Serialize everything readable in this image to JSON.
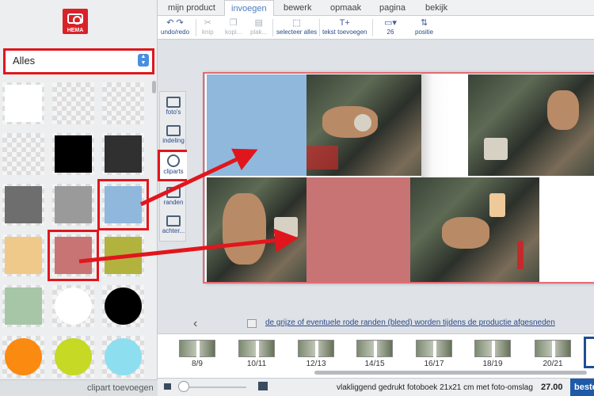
{
  "brand": {
    "name": "HEMA",
    "color": "#d8222a"
  },
  "category_select": {
    "value": "Alles"
  },
  "swatches": [
    {
      "color": "#ffffff",
      "shape": "square"
    },
    {
      "color": "transparent",
      "shape": "square"
    },
    {
      "color": "transparent",
      "shape": "square"
    },
    {
      "color": "transparent",
      "shape": "square"
    },
    {
      "color": "#000000",
      "shape": "square"
    },
    {
      "color": "#303030",
      "shape": "square"
    },
    {
      "color": "#6e6e6e",
      "shape": "square"
    },
    {
      "color": "#9a9a9a",
      "shape": "square"
    },
    {
      "color": "#8fb8dc",
      "shape": "square"
    },
    {
      "color": "#efc98a",
      "shape": "square"
    },
    {
      "color": "#c87474",
      "shape": "square"
    },
    {
      "color": "#b1b33e",
      "shape": "square"
    },
    {
      "color": "#a7c6a7",
      "shape": "square"
    },
    {
      "color": "#ffffff",
      "shape": "circle"
    },
    {
      "color": "#000000",
      "shape": "circle"
    },
    {
      "color": "#fb8a10",
      "shape": "circle"
    },
    {
      "color": "#c6d925",
      "shape": "circle"
    },
    {
      "color": "#8ddff0",
      "shape": "circle"
    }
  ],
  "sidebar_footer": {
    "clipart_add": "clipart toevoegen"
  },
  "tabs": [
    {
      "label": "mijn product",
      "active": false
    },
    {
      "label": "invoegen",
      "active": true
    },
    {
      "label": "bewerk",
      "active": false
    },
    {
      "label": "opmaak",
      "active": false
    },
    {
      "label": "pagina",
      "active": false
    },
    {
      "label": "bekijk",
      "active": false
    }
  ],
  "toolbar": {
    "undo_redo": "undo/redo",
    "knip": "knip",
    "kopi": "kopi...",
    "plak": "plak...",
    "select_all": "selecteer alles",
    "add_text": "tekst toevoegen",
    "font_size": "26",
    "position": "positie"
  },
  "side_tools": [
    {
      "label": "foto's",
      "icon": "camera-icon"
    },
    {
      "label": "indeling",
      "icon": "layout-icon"
    },
    {
      "label": "cliparts",
      "icon": "smiley-icon",
      "highlighted": true
    },
    {
      "label": "randen",
      "icon": "border-icon"
    },
    {
      "label": "achter...",
      "icon": "background-icon"
    }
  ],
  "canvas": {
    "bleed_note": "de grijze of eventuele rode randen (bleed) worden tijdens de productie afgesneden",
    "clip_blue": "#8fb8dc",
    "clip_red": "#c87474"
  },
  "thumbnails": [
    "8/9",
    "10/11",
    "12/13",
    "14/15",
    "16/17",
    "18/19",
    "20/21"
  ],
  "bottom": {
    "product": "vlakliggend gedrukt fotoboek 21x21 cm met foto-omslag",
    "price": "27.00",
    "order": "bestellen"
  },
  "annotation_color": "#e1161d"
}
